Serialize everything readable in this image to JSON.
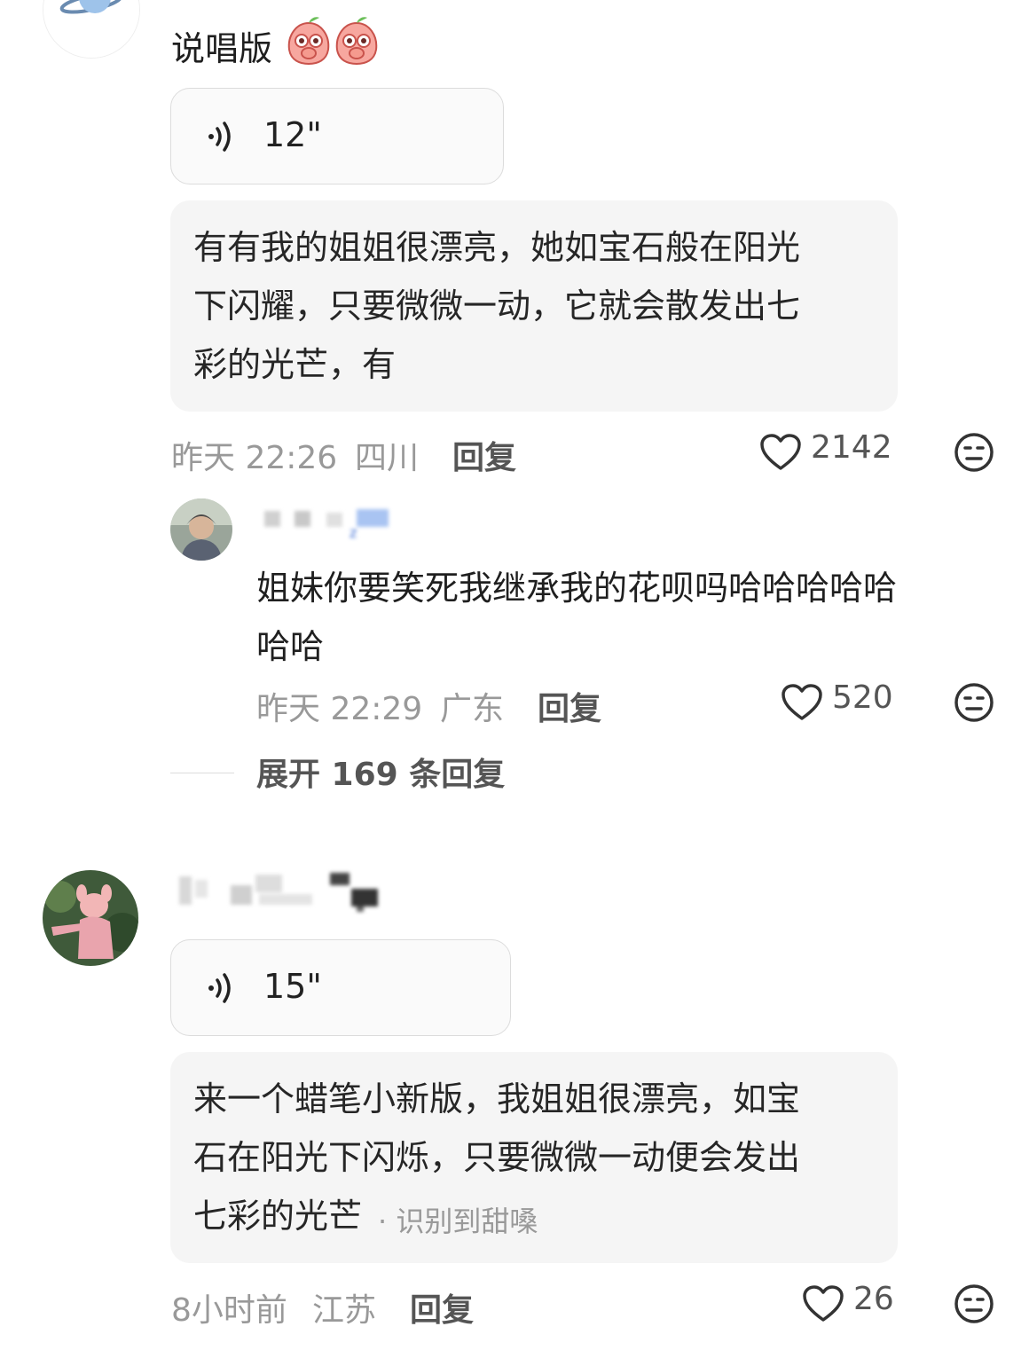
{
  "comments": [
    {
      "text": "说唱版",
      "voice_duration": "12\"",
      "transcript": "有有我的姐姐很漂亮，她如宝石般在阳光下闪耀，只要微微一动，它就会散发出七彩的光芒，有",
      "transcript_lines": [
        "有有我的姐姐很漂亮，她如宝石般在阳光",
        "下闪耀，只要微微一动，它就会散发出七",
        "彩的光芒，有"
      ],
      "time": "昨天 22:26",
      "location": "四川",
      "reply_label": "回复",
      "likes": "2142",
      "reply": {
        "text_lines": [
          "姐妹你要笑死我继承我的花呗吗哈哈哈哈哈",
          "哈哈"
        ],
        "time": "昨天 22:29",
        "location": "广东",
        "reply_label": "回复",
        "likes": "520"
      },
      "expand_label": "展开 169 条回复"
    },
    {
      "voice_duration": "15\"",
      "transcript_lines": [
        "来一个蜡笔小新版，我姐姐很漂亮，如宝",
        "石在阳光下闪烁，只要微微一动便会发出",
        "七彩的光芒"
      ],
      "recognition_note": "· 识别到甜嗓",
      "time": "8小时前",
      "location": "江苏",
      "reply_label": "回复",
      "likes": "26"
    }
  ],
  "icons": {
    "voice": "sound-wave-icon",
    "like": "heart-outline-icon",
    "dislike": "neutral-face-icon",
    "sticker": "peach-emoji-icon"
  },
  "colors": {
    "bubble_bg": "#f5f5f5",
    "meta_text": "#999999",
    "reply_text": "#555555",
    "voice_border": "#dcdcdc"
  }
}
